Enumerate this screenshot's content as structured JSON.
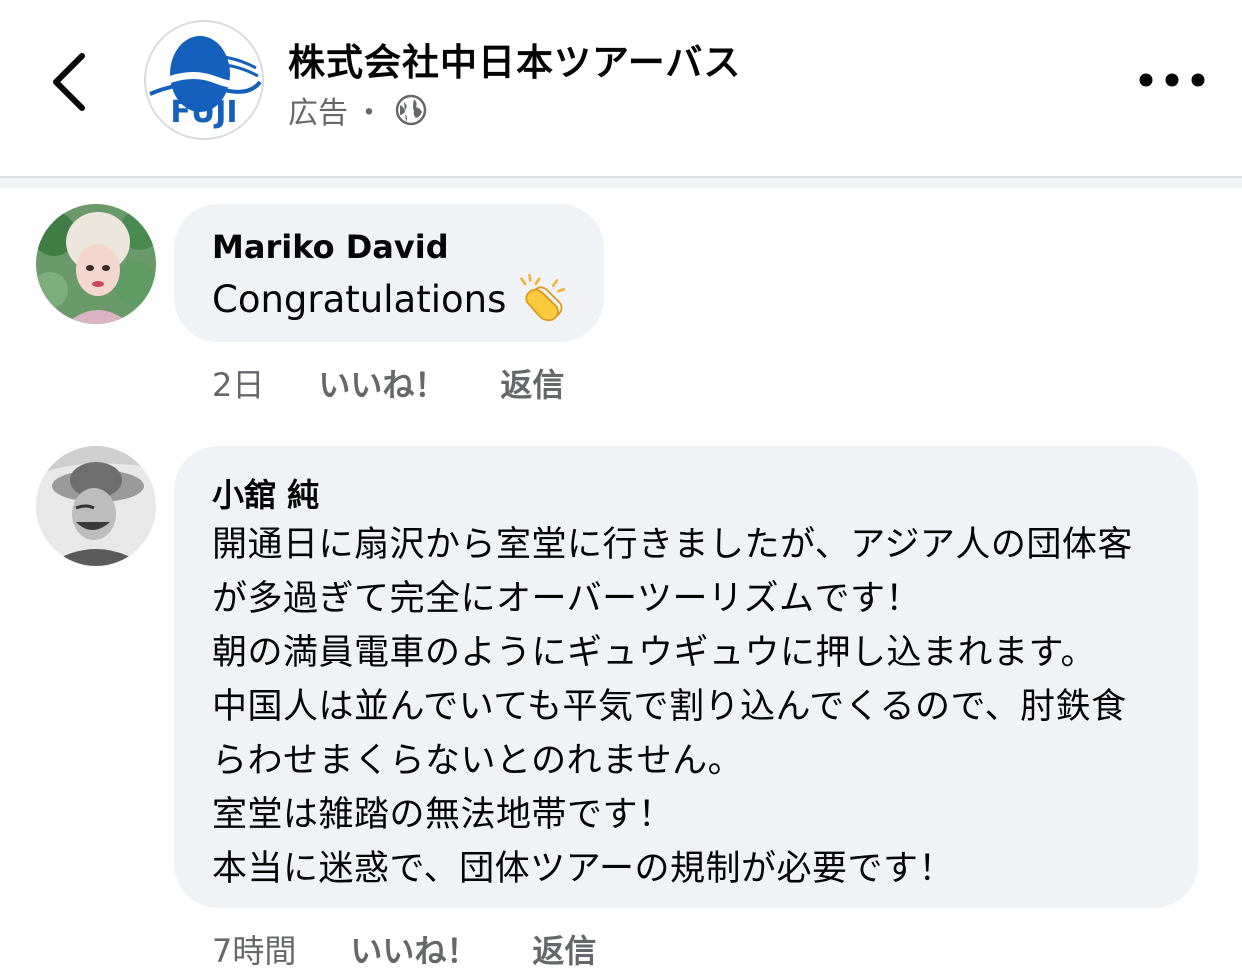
{
  "header": {
    "page_name": "株式会社中日本ツアーバス",
    "sponsored_label": "広告",
    "separator": "・",
    "logo_text": "FUJI"
  },
  "comments": [
    {
      "author": "Mariko David",
      "text": "Congratulations",
      "emoji": "clapping-hands",
      "time": "2日",
      "like_label": "いいね！",
      "reply_label": "返信"
    },
    {
      "author": "小舘 純",
      "lines": [
        "開通日に扇沢から室堂に行きましたが、アジア人の団体客",
        "が多過ぎて完全にオーバーツーリズムです！",
        "朝の満員電車のようにギュウギュウに押し込まれます。",
        "中国人は並んでいても平気で割り込んでくるので、肘鉄食",
        "らわせまくらないとのれません。",
        "室堂は雑踏の無法地帯です！",
        "本当に迷惑で、団体ツアーの規制が必要です！"
      ],
      "time": "7時間",
      "like_label": "いいね！",
      "reply_label": "返信"
    }
  ],
  "colors": {
    "bubble": "#f0f2f5",
    "secondary_text": "#65676b",
    "logo_blue": "#1560bd"
  }
}
